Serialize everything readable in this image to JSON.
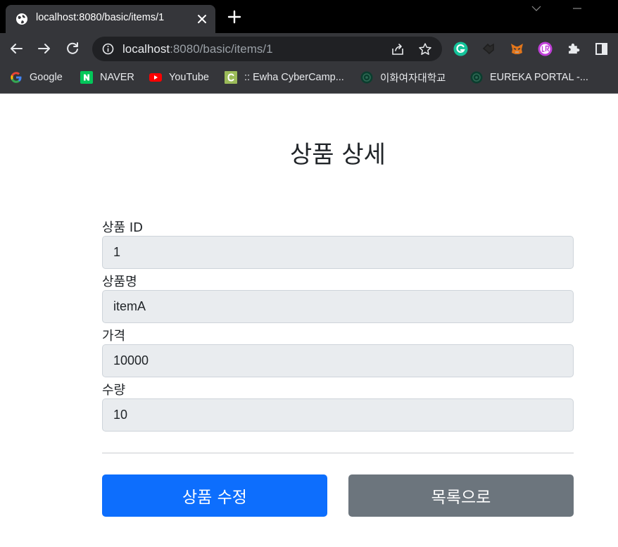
{
  "browser": {
    "tab_title": "localhost:8080/basic/items/1",
    "url_host": "localhost",
    "url_rest": ":8080/basic/items/1",
    "icons": {
      "tab": "globe-icon",
      "close": "close-icon",
      "new_tab": "plus-icon",
      "back": "back-arrow-icon",
      "forward": "forward-arrow-icon",
      "reload": "reload-icon",
      "info": "info-icon",
      "share": "share-icon",
      "bookmark": "star-icon"
    },
    "extensions": [
      "grammarly-icon",
      "extension-icon",
      "metamask-icon",
      "lr-extension-icon",
      "puzzle-icon",
      "side-panel-icon"
    ]
  },
  "bookmarks": [
    {
      "label": "Google",
      "icon": "google-icon"
    },
    {
      "label": "NAVER",
      "icon": "naver-icon"
    },
    {
      "label": "YouTube",
      "icon": "youtube-icon"
    },
    {
      "label": ":: Ewha CyberCamp...",
      "icon": "cybercamp-icon"
    },
    {
      "label": "이화여자대학교",
      "icon": "ewha-icon"
    },
    {
      "label": "EUREKA PORTAL -...",
      "icon": "ewha-icon"
    }
  ],
  "page": {
    "title": "상품 상세",
    "fields": [
      {
        "label": "상품 ID",
        "value": "1"
      },
      {
        "label": "상품명",
        "value": "itemA"
      },
      {
        "label": "가격",
        "value": "10000"
      },
      {
        "label": "수량",
        "value": "10"
      }
    ],
    "edit_button": "상품 수정",
    "list_button": "목록으로"
  },
  "colors": {
    "primary": "#0d6efd",
    "secondary": "#6c757d",
    "input_bg": "#e9ecef"
  }
}
